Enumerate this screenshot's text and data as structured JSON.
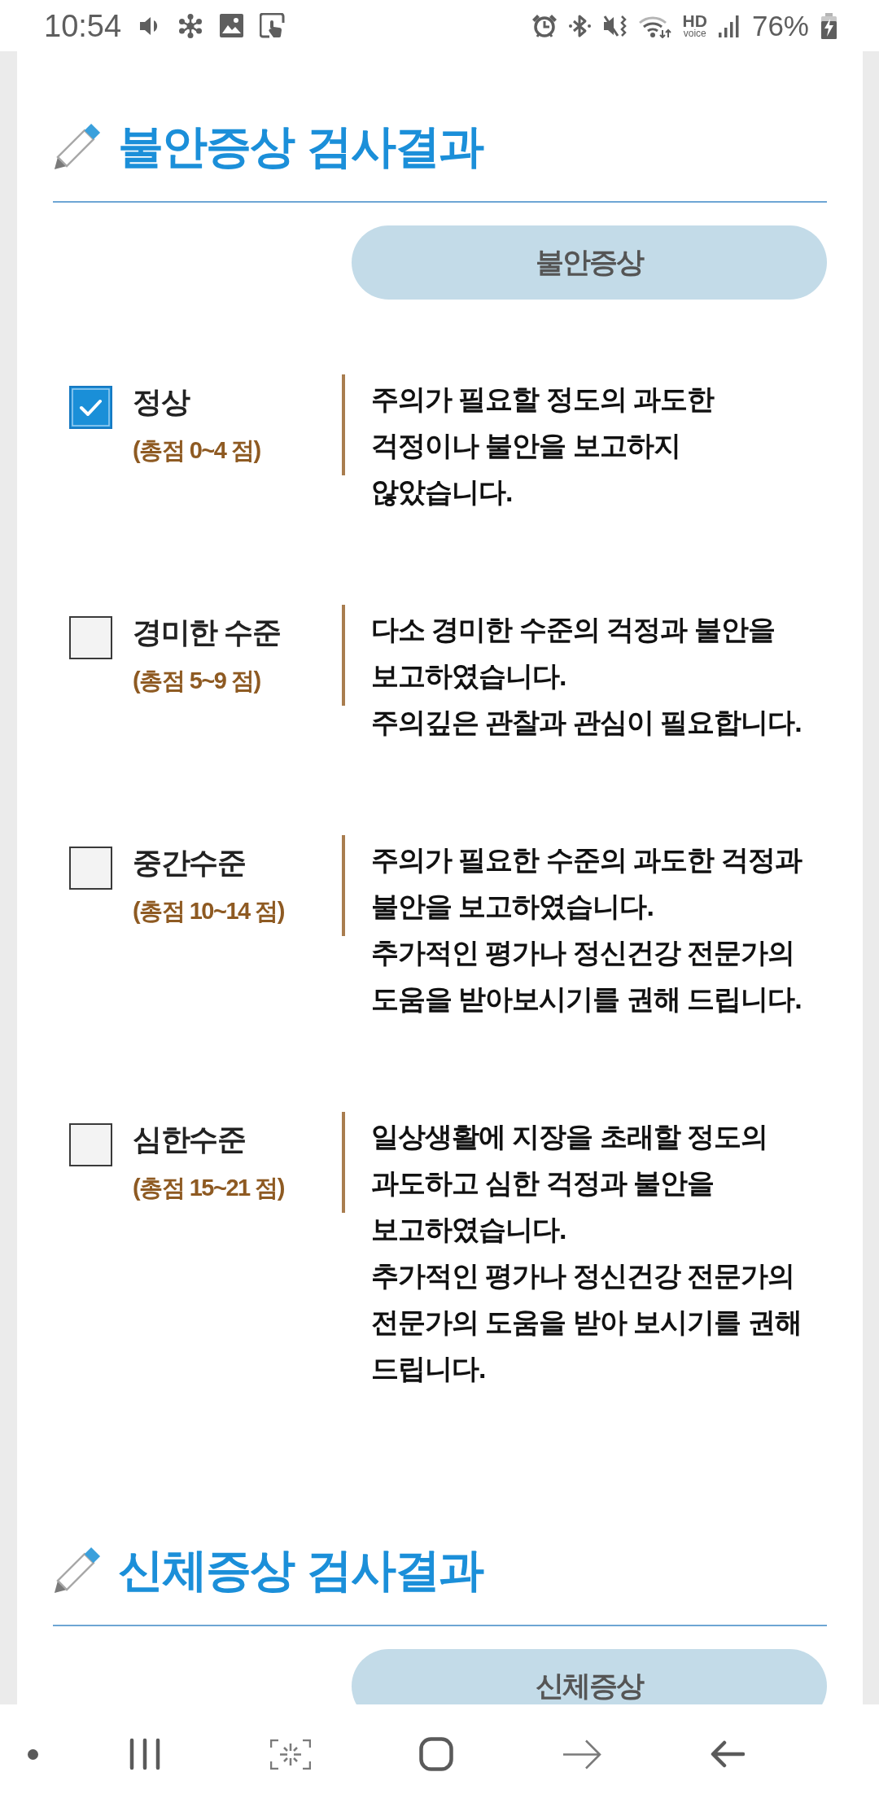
{
  "status_bar": {
    "time": "10:54",
    "hd": "HD",
    "voice": "voice",
    "battery": "76%",
    "charging": true
  },
  "sections": [
    {
      "title": "불안증상 검사결과",
      "button": "불안증상",
      "levels": [
        {
          "name": "정상",
          "score": "(총점 0~4 점)",
          "checked": true,
          "description": "주의가 필요할 정도의 과도한\n걱정이나 불안을 보고하지\n않았습니다."
        },
        {
          "name": "경미한 수준",
          "score": "(총점 5~9 점)",
          "checked": false,
          "description": "다소 경미한 수준의 걱정과 불안을\n보고하였습니다.\n주의깊은 관찰과 관심이 필요합니다."
        },
        {
          "name": "중간수준",
          "score": "(총점 10~14 점)",
          "checked": false,
          "description": "주의가 필요한 수준의 과도한 걱정과\n불안을 보고하였습니다.\n추가적인 평가나 정신건강 전문가의\n도움을 받아보시기를 권해 드립니다."
        },
        {
          "name": "심한수준",
          "score": "(총점 15~21 점)",
          "checked": false,
          "description": "일상생활에 지장을 초래할 정도의\n과도하고 심한 걱정과 불안을\n보고하였습니다.\n추가적인 평가나 정신건강 전문가의\n전문가의 도움을 받아 보시기를 권해\n드립니다."
        }
      ]
    },
    {
      "title": "신체증상 검사결과",
      "button": "신체증상"
    }
  ]
}
